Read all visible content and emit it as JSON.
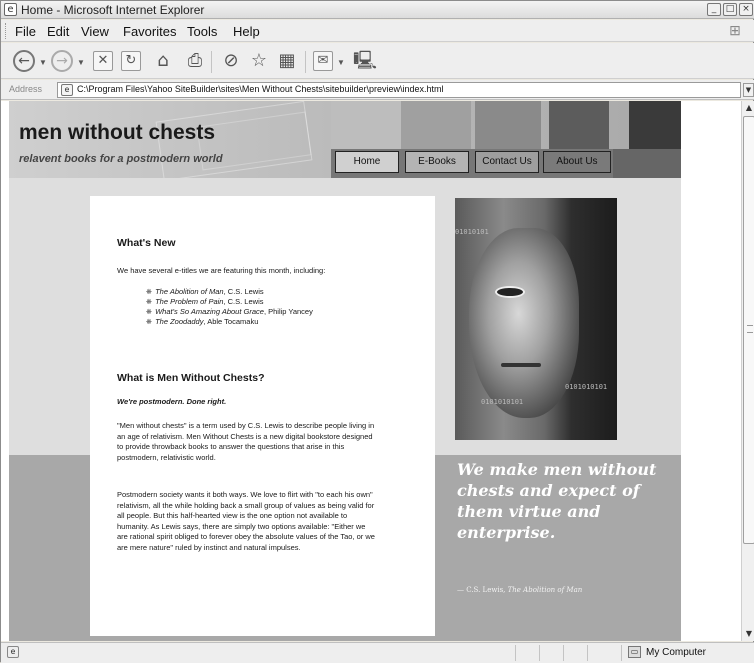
{
  "window": {
    "title": "Home - Microsoft Internet Explorer",
    "controls": [
      "_",
      "□",
      "×"
    ]
  },
  "menu": {
    "items": [
      "File",
      "Edit",
      "View",
      "Favorites",
      "Tools",
      "Help"
    ]
  },
  "toolbar": {
    "buttons": [
      "back-icon",
      "forward-icon",
      "stop-icon",
      "refresh-icon",
      "home-icon",
      "print-icon",
      "search-icon",
      "favorites-icon",
      "media-icon",
      "mail-icon",
      "messenger-icon"
    ]
  },
  "address": {
    "label": "Address",
    "url": "C:\\Program Files\\Yahoo SiteBuilder\\sites\\Men Without Chests\\sitebuilder\\preview\\index.html"
  },
  "site": {
    "title": "men without chests",
    "tagline": "relavent books for a postmodern world",
    "nav": [
      "Home",
      "E-Books",
      "Contact Us",
      "About Us"
    ],
    "swatch_colors": [
      "#bdbdbd",
      "#a0a0a0",
      "#8a8a8a",
      "#5c5c5c",
      "#3a3a3a"
    ]
  },
  "content": {
    "whats_new_heading": "What's New",
    "whats_new_intro": "We have several e-titles we are featuring this month, including:",
    "books": [
      {
        "title": "The Abolition of Man",
        "author": ", C.S. Lewis"
      },
      {
        "title": "The Problem of Pain",
        "author": ", C.S. Lewis"
      },
      {
        "title": "What's So Amazing About Grace",
        "author": ", Philip Yancey"
      },
      {
        "title": "The Zoodaddy",
        "author": ", Able Tocamaku"
      }
    ],
    "about_heading": "What is Men Without Chests?",
    "slogan": "We're postmodern. Done right.",
    "para1": "\"Men without chests\" is a term used by C.S. Lewis to describe people living in an age of relativism. Men Without Chests is a new digital bookstore designed to provide throwback books to answer the questions that arise in this postmodern, relativistic world.",
    "para2": "Postmodern society wants it both ways. We love to flirt with \"to each his own\" relativism, all the while holding back a small group of values as being valid for all people. But this half-hearted view is the one option not available to humanity. As Lewis says, there are simply two options available: \"Either we are rational spirit obliged to forever obey the absolute values of the Tao, or we are mere nature\" ruled by instinct and natural impulses."
  },
  "hero": {
    "binary": [
      "01010101",
      "0101010101",
      "0101010101"
    ]
  },
  "quote": {
    "text": "We make men without chests and expect of them virtue and enterprise.",
    "cite_prefix": "— C.S. Lewis, ",
    "cite_title": "The Abolition of Man"
  },
  "status": {
    "zone": "My Computer"
  }
}
